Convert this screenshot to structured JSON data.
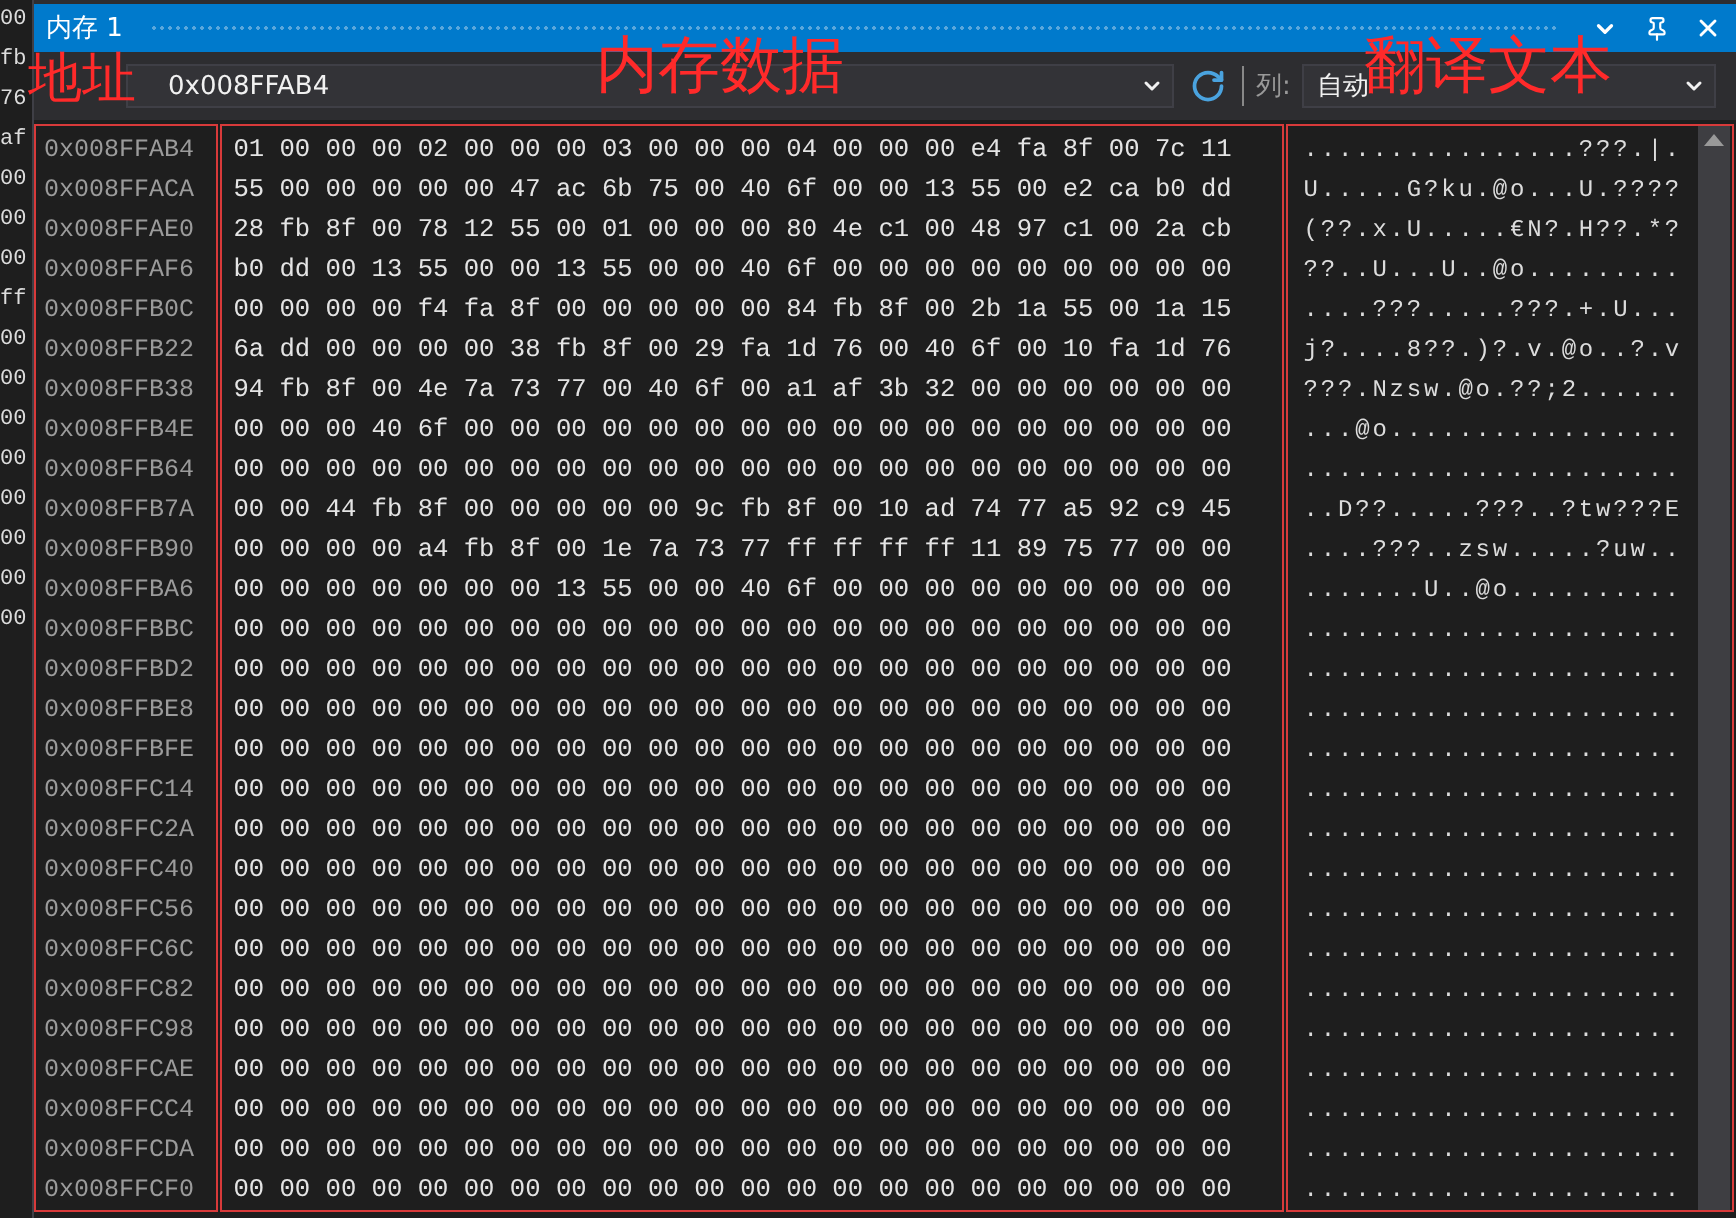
{
  "window": {
    "title": "内存 1"
  },
  "toolbar": {
    "address": "0x008FFAB4",
    "columns_label": "列:",
    "columns_value": "自动"
  },
  "annotations": [
    {
      "kind": "address",
      "text": "地址"
    },
    {
      "kind": "data",
      "text": "内存数据"
    },
    {
      "kind": "text",
      "text": "翻译文本"
    }
  ],
  "left_fragments": [
    "00",
    "fb",
    "76",
    "af",
    "00",
    "00",
    "00",
    "ff",
    "00",
    "00",
    "00",
    "00",
    "00",
    "00",
    "00",
    "00"
  ],
  "rows": [
    {
      "address": "0x008FFAB4",
      "bytes": "01 00 00 00 02 00 00 00 03 00 00 00 04 00 00 00 e4 fa 8f 00 7c 11",
      "text": "................???.|."
    },
    {
      "address": "0x008FFACA",
      "bytes": "55 00 00 00 00 00 47 ac 6b 75 00 40 6f 00 00 13 55 00 e2 ca b0 dd",
      "text": "U.....G?ku.@o...U.????"
    },
    {
      "address": "0x008FFAE0",
      "bytes": "28 fb 8f 00 78 12 55 00 01 00 00 00 80 4e c1 00 48 97 c1 00 2a cb",
      "text": "(??.x.U.....€N?.H??.*?"
    },
    {
      "address": "0x008FFAF6",
      "bytes": "b0 dd 00 13 55 00 00 13 55 00 00 40 6f 00 00 00 00 00 00 00 00 00",
      "text": "??..U...U..@o........."
    },
    {
      "address": "0x008FFB0C",
      "bytes": "00 00 00 00 f4 fa 8f 00 00 00 00 00 84 fb 8f 00 2b 1a 55 00 1a 15",
      "text": "....???.....???.+.U..."
    },
    {
      "address": "0x008FFB22",
      "bytes": "6a dd 00 00 00 00 38 fb 8f 00 29 fa 1d 76 00 40 6f 00 10 fa 1d 76",
      "text": "j?....8??.)?.v.@o..?.v"
    },
    {
      "address": "0x008FFB38",
      "bytes": "94 fb 8f 00 4e 7a 73 77 00 40 6f 00 a1 af 3b 32 00 00 00 00 00 00",
      "text": "???.Nzsw.@o.??;2......"
    },
    {
      "address": "0x008FFB4E",
      "bytes": "00 00 00 40 6f 00 00 00 00 00 00 00 00 00 00 00 00 00 00 00 00 00",
      "text": "...@o................."
    },
    {
      "address": "0x008FFB64",
      "bytes": "00 00 00 00 00 00 00 00 00 00 00 00 00 00 00 00 00 00 00 00 00 00",
      "text": "......................"
    },
    {
      "address": "0x008FFB7A",
      "bytes": "00 00 44 fb 8f 00 00 00 00 00 9c fb 8f 00 10 ad 74 77 a5 92 c9 45",
      "text": "..D??.....???..?tw???E"
    },
    {
      "address": "0x008FFB90",
      "bytes": "00 00 00 00 a4 fb 8f 00 1e 7a 73 77 ff ff ff ff 11 89 75 77 00 00",
      "text": "....???..zsw.....?uw.."
    },
    {
      "address": "0x008FFBA6",
      "bytes": "00 00 00 00 00 00 00 13 55 00 00 40 6f 00 00 00 00 00 00 00 00 00",
      "text": ".......U..@o.........."
    },
    {
      "address": "0x008FFBBC",
      "bytes": "00 00 00 00 00 00 00 00 00 00 00 00 00 00 00 00 00 00 00 00 00 00",
      "text": "......................"
    },
    {
      "address": "0x008FFBD2",
      "bytes": "00 00 00 00 00 00 00 00 00 00 00 00 00 00 00 00 00 00 00 00 00 00",
      "text": "......................"
    },
    {
      "address": "0x008FFBE8",
      "bytes": "00 00 00 00 00 00 00 00 00 00 00 00 00 00 00 00 00 00 00 00 00 00",
      "text": "......................"
    },
    {
      "address": "0x008FFBFE",
      "bytes": "00 00 00 00 00 00 00 00 00 00 00 00 00 00 00 00 00 00 00 00 00 00",
      "text": "......................"
    },
    {
      "address": "0x008FFC14",
      "bytes": "00 00 00 00 00 00 00 00 00 00 00 00 00 00 00 00 00 00 00 00 00 00",
      "text": "......................"
    },
    {
      "address": "0x008FFC2A",
      "bytes": "00 00 00 00 00 00 00 00 00 00 00 00 00 00 00 00 00 00 00 00 00 00",
      "text": "......................"
    },
    {
      "address": "0x008FFC40",
      "bytes": "00 00 00 00 00 00 00 00 00 00 00 00 00 00 00 00 00 00 00 00 00 00",
      "text": "......................"
    },
    {
      "address": "0x008FFC56",
      "bytes": "00 00 00 00 00 00 00 00 00 00 00 00 00 00 00 00 00 00 00 00 00 00",
      "text": "......................"
    },
    {
      "address": "0x008FFC6C",
      "bytes": "00 00 00 00 00 00 00 00 00 00 00 00 00 00 00 00 00 00 00 00 00 00",
      "text": "......................"
    },
    {
      "address": "0x008FFC82",
      "bytes": "00 00 00 00 00 00 00 00 00 00 00 00 00 00 00 00 00 00 00 00 00 00",
      "text": "......................"
    },
    {
      "address": "0x008FFC98",
      "bytes": "00 00 00 00 00 00 00 00 00 00 00 00 00 00 00 00 00 00 00 00 00 00",
      "text": "......................"
    },
    {
      "address": "0x008FFCAE",
      "bytes": "00 00 00 00 00 00 00 00 00 00 00 00 00 00 00 00 00 00 00 00 00 00",
      "text": "......................"
    },
    {
      "address": "0x008FFCC4",
      "bytes": "00 00 00 00 00 00 00 00 00 00 00 00 00 00 00 00 00 00 00 00 00 00",
      "text": "......................"
    },
    {
      "address": "0x008FFCDA",
      "bytes": "00 00 00 00 00 00 00 00 00 00 00 00 00 00 00 00 00 00 00 00 00 00",
      "text": "......................"
    },
    {
      "address": "0x008FFCF0",
      "bytes": "00 00 00 00 00 00 00 00 00 00 00 00 00 00 00 00 00 00 00 00 00 00",
      "text": "......................"
    }
  ]
}
